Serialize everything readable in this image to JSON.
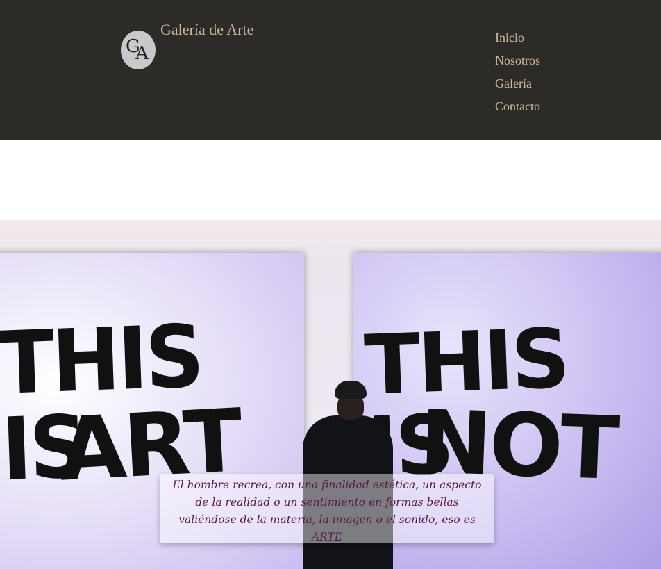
{
  "header": {
    "logo_letters": {
      "first": "G",
      "second": "A"
    },
    "title": "Galería de Arte",
    "nav": [
      "Inicio",
      "Nosotros",
      "Galería",
      "Contacto"
    ]
  },
  "hero": {
    "artwork_left": {
      "line1": "THIS IS",
      "line2": "ART"
    },
    "artwork_right": {
      "line1": "THIS IS",
      "line2": "NOT"
    },
    "quote": "El hombre recrea, con una finalidad estética, un aspecto de la realidad o un sentimiento en formas bellas valiéndose de la materia, la imagen o el sonido, eso es ARTE"
  },
  "colors": {
    "header_bg": "#2d2b28",
    "nav_text": "#cdb998",
    "title_text": "#c9b89b",
    "quote_text": "#5a1747"
  }
}
